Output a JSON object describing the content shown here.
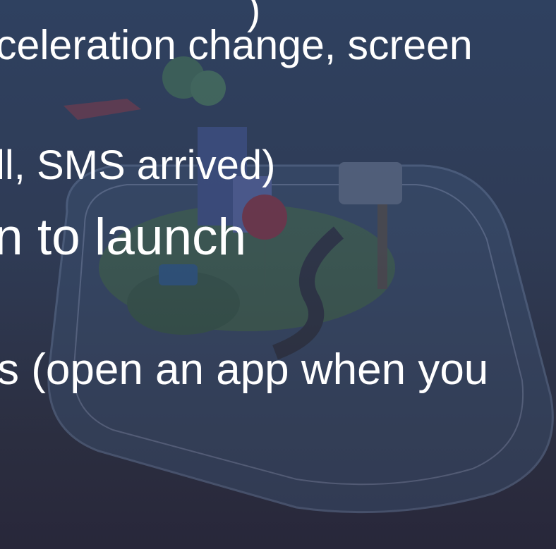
{
  "slide": {
    "lines": [
      ")",
      "celeration change, screen",
      "ll, SMS arrived)",
      "n to launch",
      "s (open an app when you"
    ]
  }
}
